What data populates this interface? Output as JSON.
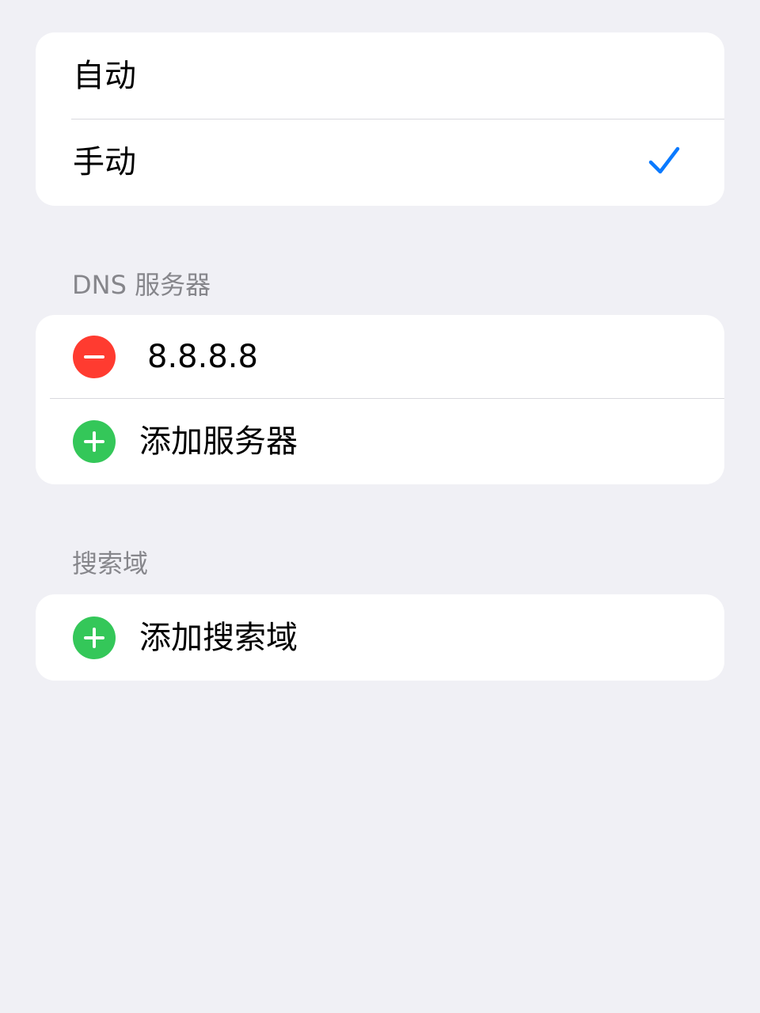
{
  "mode_options": {
    "auto_label": "自动",
    "manual_label": "手动",
    "selected": "手动"
  },
  "dns_section": {
    "header": "DNS 服务器",
    "servers": [
      "8.8.8.8"
    ],
    "add_label": "添加服务器"
  },
  "search_domain_section": {
    "header": "搜索域",
    "add_label": "添加搜索域"
  },
  "icons": {
    "selected": "checkmark-icon",
    "remove": "minus-circle-icon",
    "add": "plus-circle-icon"
  },
  "colors": {
    "accent": "#0a7aff",
    "remove": "#ff3b30",
    "add": "#34c759",
    "background": "#f0f0f5",
    "section_header": "#86868b"
  }
}
